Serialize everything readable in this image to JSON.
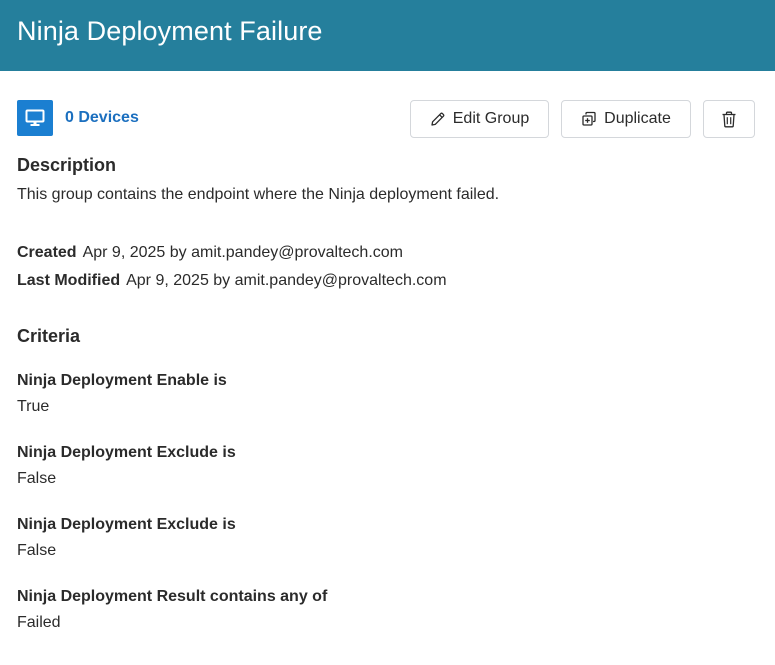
{
  "header": {
    "title": "Ninja Deployment Failure"
  },
  "toolbar": {
    "devices_label": "0 Devices",
    "device_icon": "monitor-icon",
    "edit_label": "Edit Group",
    "edit_icon": "pencil-icon",
    "duplicate_label": "Duplicate",
    "duplicate_icon": "copy-icon",
    "delete_icon": "trash-icon"
  },
  "description": {
    "heading": "Description",
    "text": "This group contains the endpoint where the Ninja deployment failed."
  },
  "meta": {
    "created_label": "Created",
    "created_value": "Apr 9, 2025 by amit.pandey@provaltech.com",
    "modified_label": "Last Modified",
    "modified_value": "Apr 9, 2025 by amit.pandey@provaltech.com"
  },
  "criteria": {
    "heading": "Criteria",
    "items": [
      {
        "label": "Ninja Deployment Enable is",
        "value": "True"
      },
      {
        "label": "Ninja Deployment Exclude is",
        "value": "False"
      },
      {
        "label": "Ninja Deployment Exclude is",
        "value": "False"
      },
      {
        "label": "Ninja Deployment Result contains any of",
        "value": "Failed"
      }
    ]
  },
  "colors": {
    "header_bg": "#257f9c",
    "accent_blue": "#1b7fd1",
    "link_blue": "#1b6fbf"
  }
}
